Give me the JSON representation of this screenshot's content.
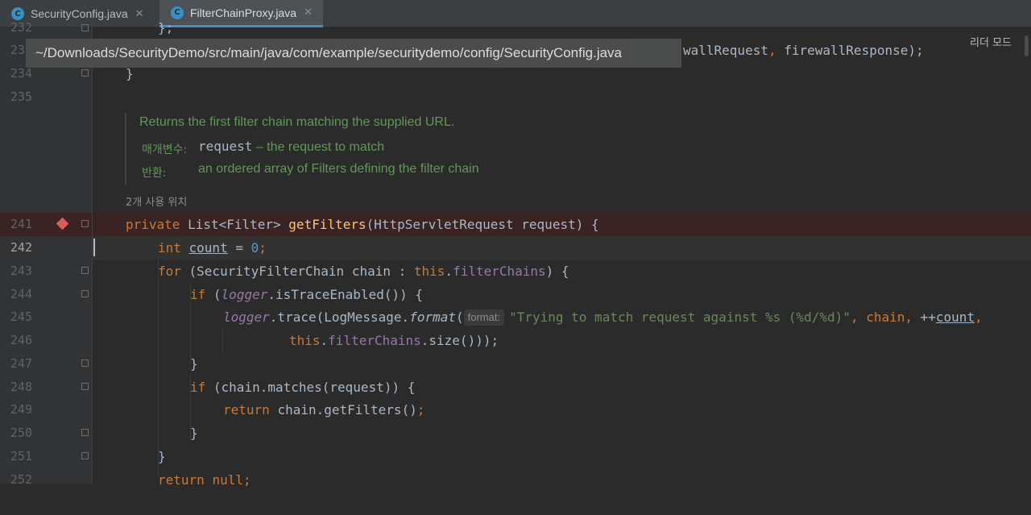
{
  "tabs": [
    {
      "icon": "C",
      "label": "SecurityConfig.java",
      "close": "✕"
    },
    {
      "icon": "C",
      "label": "FilterChainProxy.java",
      "close": "✕"
    }
  ],
  "tooltip": "~/Downloads/SecurityDemo/src/main/java/com/example/securitydemo/config/SecurityConfig.java",
  "reader_mode": "리더 모드",
  "line_numbers": [
    "232",
    "233",
    "234",
    "235",
    "241",
    "242",
    "243",
    "244",
    "245",
    "246",
    "247",
    "248",
    "249",
    "250",
    "251",
    "252"
  ],
  "code": {
    "l232": "};",
    "l233_a": "wallRequest",
    "l233_b": ", ",
    "l233_c": "firewallResponse);",
    "l234": "}",
    "l241_kw": "private ",
    "l241_type": "List<Filter> ",
    "l241_fn": "getFilters",
    "l241_rest": "(HttpServletRequest request) {",
    "l242_kw": "int ",
    "l242_var": "count",
    "l242_eq": " = ",
    "l242_num": "0",
    "l242_end": ";",
    "l243_kw": "for ",
    "l243_a": "(SecurityFilterChain chain : ",
    "l243_this": "this",
    "l243_dot": ".",
    "l243_fld": "filterChains",
    "l243_end": ") {",
    "l244_kw": "if ",
    "l244_a": "(",
    "l244_logger": "logger",
    "l244_b": ".isTraceEnabled()) {",
    "l245_logger": "logger",
    "l245_a": ".trace(LogMessage.",
    "l245_fmt": "format",
    "l245_b": "(",
    "l245_hint": "format:",
    "l245_str": "\"Trying to match request against %s (%d/%d)\"",
    "l245_c": ", chain",
    "l245_d": ", ",
    "l245_e": "++",
    "l245_count": "count",
    "l245_f": ",",
    "l246_this": "this",
    "l246_dot": ".",
    "l246_fld": "filterChains",
    "l246_end": ".size()));",
    "l247": "}",
    "l248_kw": "if ",
    "l248_rest": "(chain.matches(request)) {",
    "l249_kw": "return ",
    "l249_rest": "chain.getFilters()",
    "l249_end": ";",
    "l250": "}",
    "l251": "}",
    "l252_kw": "return ",
    "l252_null": "null",
    "l252_end": ";"
  },
  "doc": {
    "summary": "Returns the first filter chain matching the supplied URL.",
    "param_label": "매개변수:",
    "param_name": "request",
    "param_desc": " – the request to match",
    "return_label": "반환:",
    "return_desc": "an ordered array of Filters defining the filter chain",
    "usages": "2개 사용 위치"
  },
  "colors": {
    "background": "#2b2b2b",
    "keyword": "#cc7832",
    "function": "#ffc66d",
    "field": "#9876aa",
    "string": "#6a8759",
    "number": "#6897bb",
    "doc": "#629755",
    "breakpoint": "#db5c5c"
  }
}
